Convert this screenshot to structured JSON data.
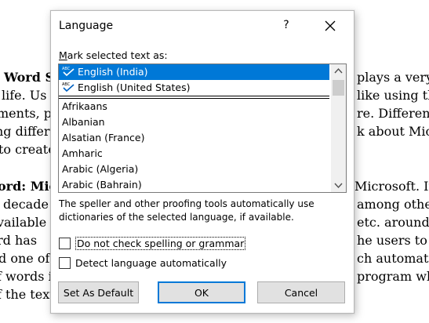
{
  "background_doc": {
    "lines": [
      {
        "text": "t Word S"
      },
      {
        "text": "life. Us"
      },
      {
        "text": "ments, pla"
      },
      {
        "text": "ng differ"
      },
      {
        "text": "to create"
      },
      {
        "text": "ord: Mic"
      },
      {
        "text": "decade"
      },
      {
        "text": "vailable"
      },
      {
        "text": "rd has"
      },
      {
        "text": "d one of"
      },
      {
        "text": "f words i"
      },
      {
        "text": "f the text"
      },
      {
        "text": "plays a very"
      },
      {
        "text": "like using th"
      },
      {
        "text": "re. Differen"
      },
      {
        "text": "k about Micr"
      },
      {
        "text": "Microsoft. It"
      },
      {
        "text": "among other"
      },
      {
        "text": "etc. around"
      },
      {
        "text": "he users to"
      },
      {
        "text": "ch automatic"
      },
      {
        "text": "program wh"
      }
    ]
  },
  "dialog": {
    "title": "Language",
    "help_label": "?",
    "close_icon": "close-icon",
    "field_label_prefix": "M",
    "field_label_rest": "ark selected text as:",
    "languages": [
      {
        "label": "English (India)",
        "selected": true,
        "pinned": true
      },
      {
        "label": "English (United States)",
        "selected": false,
        "pinned": true
      },
      {
        "label": "Afrikaans"
      },
      {
        "label": "Albanian"
      },
      {
        "label": "Alsatian (France)"
      },
      {
        "label": "Amharic"
      },
      {
        "label": "Arabic (Algeria)"
      },
      {
        "label": "Arabic (Bahrain)"
      }
    ],
    "description": "The speller and other proofing tools automatically use dictionaries of the selected language, if available.",
    "no_spellcheck_label": "Do not check spelling or grammar",
    "detect_label": "Detect language automatically",
    "no_spellcheck_checked": false,
    "detect_checked": false,
    "set_default_label": "Set As Default",
    "ok_label": "OK",
    "cancel_label": "Cancel",
    "accent_color": "#0078d7"
  }
}
